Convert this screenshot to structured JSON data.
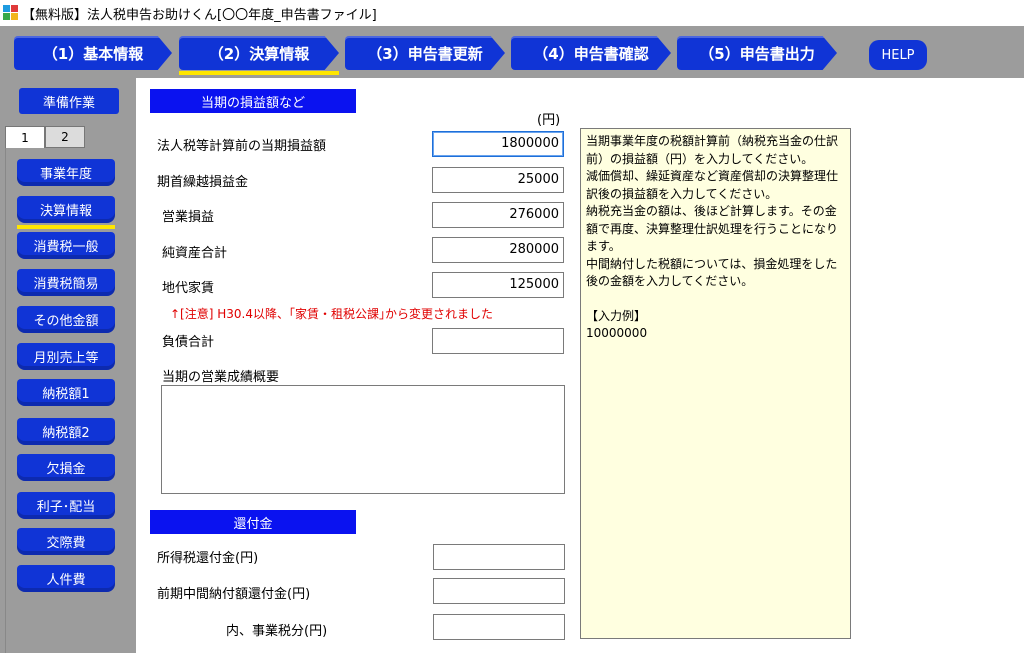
{
  "window": {
    "title": "【無料版】法人税申告お助けくん[〇〇年度_申告書ファイル]"
  },
  "topnav": {
    "tabs": [
      {
        "label": "（1）基本情報"
      },
      {
        "label": "（2）決算情報"
      },
      {
        "label": "（3）申告書更新"
      },
      {
        "label": "（4）申告書確認"
      },
      {
        "label": "（5）申告書出力"
      }
    ],
    "help_label": "HELP",
    "active_tab": 1
  },
  "sidebar": {
    "prep_label": "準備作業",
    "subtabs": [
      {
        "label": "1"
      },
      {
        "label": "2"
      }
    ],
    "items": [
      {
        "label": "事業年度"
      },
      {
        "label": "決算情報"
      },
      {
        "label": "消費税一般"
      },
      {
        "label": "消費税簡易"
      },
      {
        "label": "その他金額"
      },
      {
        "label": "月別売上等"
      },
      {
        "label": "納税額1"
      },
      {
        "label": "納税額2"
      },
      {
        "label": "欠損金"
      },
      {
        "label": "利子･配当"
      },
      {
        "label": "交際費"
      },
      {
        "label": "人件費"
      }
    ],
    "active_item": 1
  },
  "profit": {
    "heading": "当期の損益額など",
    "unit": "(円)",
    "rows": [
      {
        "label": "法人税等計算前の当期損益額",
        "value": "1800000"
      },
      {
        "label": "期首繰越損益金",
        "value": "25000"
      },
      {
        "label": "営業損益",
        "value": "276000"
      },
      {
        "label": "純資産合計",
        "value": "280000"
      },
      {
        "label": "地代家賃",
        "value": "125000"
      }
    ],
    "notice": "↑[注意] H30.4以降、｢家賃・租税公課｣から変更されました",
    "liabilities_label": "負債合計",
    "liabilities_value": "",
    "summary_label": "当期の営業成績概要",
    "summary_value": ""
  },
  "refund": {
    "heading": "還付金",
    "rows": [
      {
        "label": "所得税還付金(円)",
        "value": ""
      },
      {
        "label": "前期中間納付額還付金(円)",
        "value": ""
      },
      {
        "label": "内、事業税分(円)",
        "value": ""
      }
    ]
  },
  "help_text": {
    "p1": "当期事業年度の税額計算前（納税充当金の仕訳前）の損益額（円）を入力してください。\n減価償却、繰延資産など資産償却の決算整理仕訳後の損益額を入力してください。\n納税充当金の額は、後ほど計算します。その金額で再度、決算整理仕訳処理を行うことになります。\n中間納付した税額については、損金処理をした後の金額を入力してください。",
    "p2": "【入力例】\n10000000"
  },
  "colors": {
    "nav_blue": "#1034d6",
    "section_blue": "#0a12f0",
    "active_underline": "#ffe600",
    "notice_red": "#e00000",
    "help_bg": "#ffffe0"
  }
}
